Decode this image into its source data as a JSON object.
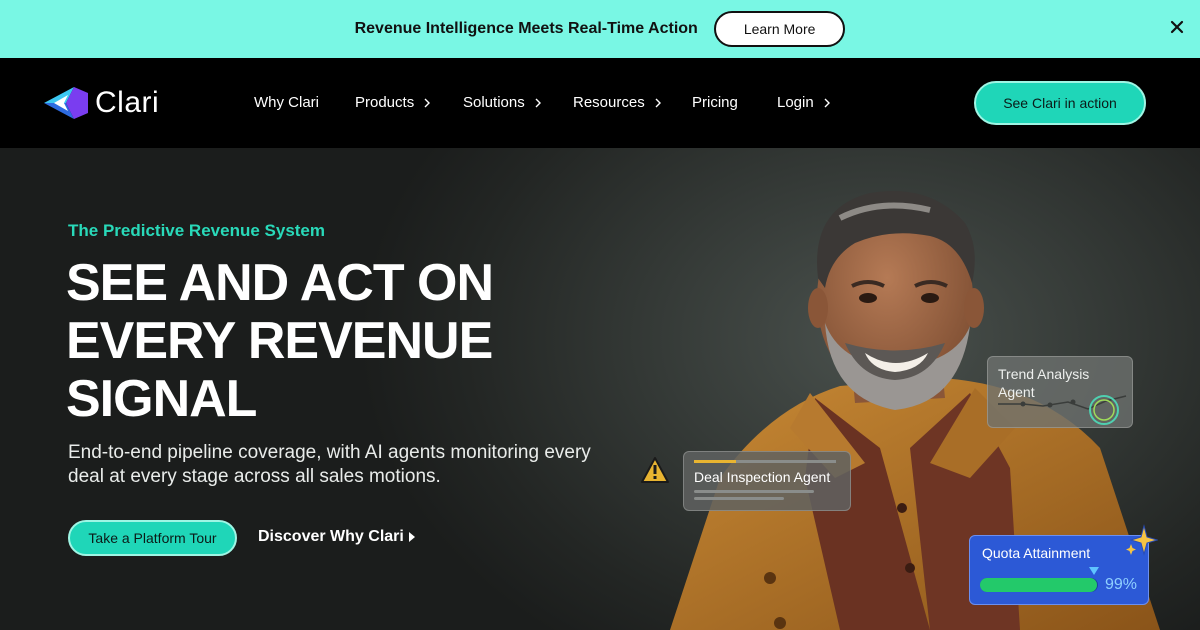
{
  "banner": {
    "text": "Revenue Intelligence Meets Real-Time Action",
    "button_label": "Learn More"
  },
  "nav": {
    "logo_text": "Clari",
    "items": [
      {
        "label": "Why Clari",
        "has_chevron": false
      },
      {
        "label": "Products",
        "has_chevron": true
      },
      {
        "label": "Solutions",
        "has_chevron": true
      },
      {
        "label": "Resources",
        "has_chevron": true
      },
      {
        "label": "Pricing",
        "has_chevron": false
      },
      {
        "label": "Login",
        "has_chevron": true
      }
    ],
    "cta_label": "See Clari in action"
  },
  "hero": {
    "eyebrow": "The Predictive Revenue System",
    "headline_lines": [
      "SEE AND ACT ON",
      "EVERY REVENUE",
      "SIGNAL"
    ],
    "subhead": "End-to-end pipeline coverage, with AI agents monitoring every deal at every stage across all sales motions.",
    "primary_cta": "Take a Platform Tour",
    "secondary_cta": "Discover Why Clari"
  },
  "cards": {
    "trend": {
      "title": "Trend Analysis Agent"
    },
    "deal": {
      "title": "Deal Inspection Agent"
    },
    "quota": {
      "title": "Quota Attainment",
      "percent_label": "99%",
      "fill_fraction": 0.99
    }
  },
  "colors": {
    "banner_bg": "#79f7e4",
    "accent": "#1fd6b8",
    "eyebrow": "#29d9b9",
    "quota_card": "#2c59d6",
    "quota_fill": "#23c96a",
    "warning": "#e8b431"
  },
  "icons": [
    "close-icon",
    "clari-logo-icon",
    "chevron-right-icon",
    "warning-icon",
    "sparkle-icon",
    "play-triangle-icon"
  ]
}
